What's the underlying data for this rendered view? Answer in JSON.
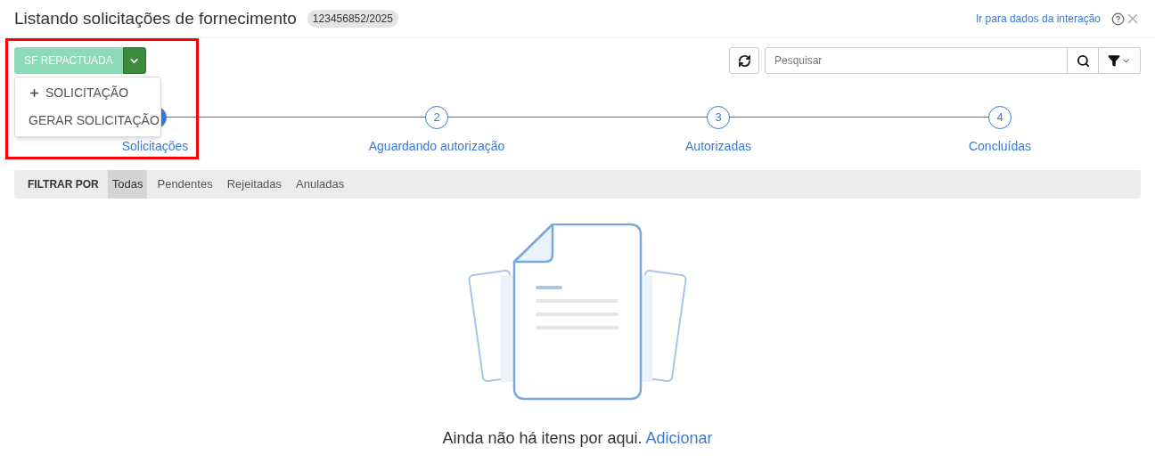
{
  "header": {
    "title": "Listando solicitações de fornecimento",
    "badge": "123456852/2025",
    "link": "Ir para dados da interação"
  },
  "action_button": {
    "label": "SF REPACTUADA",
    "expanded": true
  },
  "menu": [
    {
      "kind": "add",
      "label": "SOLICITAÇÃO"
    },
    {
      "kind": "plain",
      "label": "GERAR SOLICITAÇÃO"
    }
  ],
  "search": {
    "placeholder": "Pesquisar"
  },
  "steps": [
    {
      "label": "Solicitações",
      "selected": true
    },
    {
      "number": "2",
      "label": "Aguardando autorização",
      "selected": false
    },
    {
      "number": "3",
      "label": "Autorizadas",
      "selected": false
    },
    {
      "number": "4",
      "label": "Concluídas",
      "selected": false
    }
  ],
  "filter": {
    "label": "FILTRAR POR",
    "options": [
      {
        "label": "Todas",
        "selected": true
      },
      {
        "label": "Pendentes",
        "selected": false
      },
      {
        "label": "Rejeitadas",
        "selected": false
      },
      {
        "label": "Anuladas",
        "selected": false
      }
    ]
  },
  "empty_state": {
    "message": "Ainda não há itens por aqui.",
    "link": "Adicionar"
  },
  "highlight": true
}
